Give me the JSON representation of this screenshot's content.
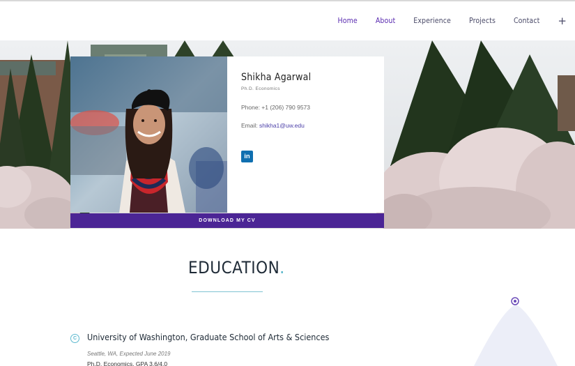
{
  "nav": {
    "items": [
      {
        "label": "Home",
        "accent": true
      },
      {
        "label": "About",
        "accent": true
      },
      {
        "label": "Experience",
        "accent": false
      },
      {
        "label": "Projects",
        "accent": false
      },
      {
        "label": "Contact",
        "accent": false
      }
    ],
    "more_icon": "plus-icon",
    "more_label": "+"
  },
  "profile": {
    "name": "Shikha Agarwal",
    "degree": "Ph.D. Economics",
    "phone": "Phone: +1 (206) 790 9573",
    "email_label": "Email: ",
    "email": "shikha1@uw.edu",
    "social_icon": "linkedin-icon",
    "social_label": "in",
    "cv_button": "DOWNLOAD MY CV"
  },
  "education": {
    "title": "EDUCATION",
    "title_dot": ".",
    "entries": [
      {
        "icon": "education-icon",
        "icon_label": "C",
        "school": "University of Washington, Graduate School of Arts & Sciences",
        "location": "Seattle, WA, Expected June 2019",
        "program": "Ph.D. Economics, GPA 3.6/4.0"
      }
    ]
  },
  "colors": {
    "accent": "#4b2595",
    "nav_accent": "#5a2bb0",
    "link": "#4b3fa8",
    "teal": "#4fb3c8",
    "linkedin": "#0f6fb0"
  }
}
